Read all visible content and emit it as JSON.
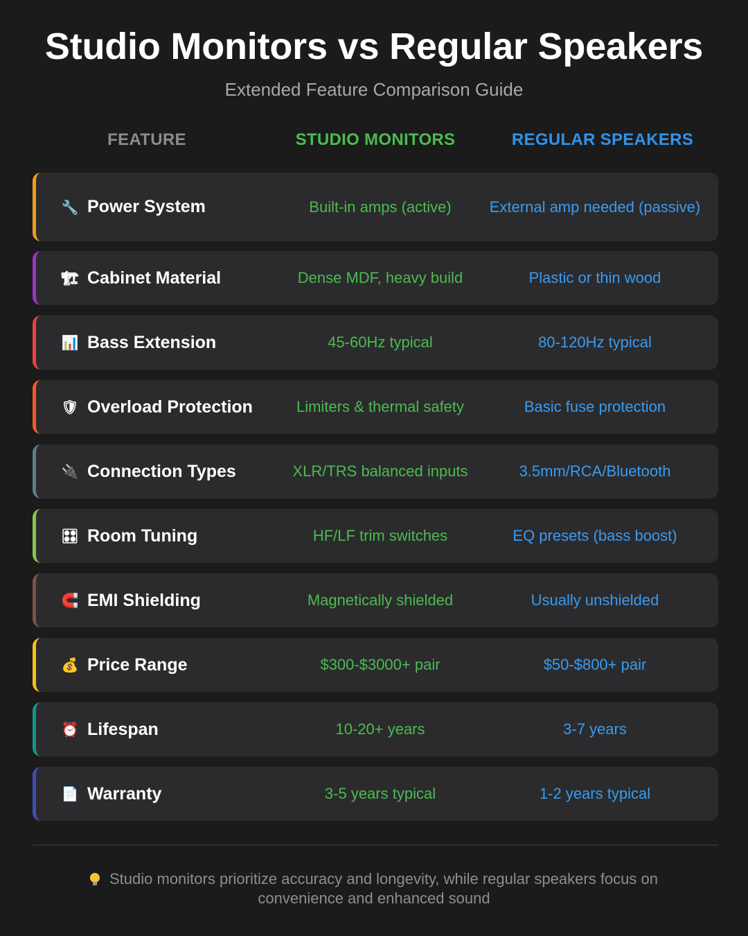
{
  "title": "Studio Monitors vs Regular Speakers",
  "subtitle": "Extended Feature Comparison Guide",
  "columns": {
    "feature": "FEATURE",
    "studio": "STUDIO MONITORS",
    "regular": "REGULAR SPEAKERS"
  },
  "colors": {
    "studio": "#4cbb4f",
    "regular": "#3a9bf0"
  },
  "rows": [
    {
      "feature": "Power System",
      "icon": "wrench-icon",
      "glyph": "🔧",
      "accent": "#f29b1c",
      "studio": "Built-in amps (active)",
      "regular": "External amp needed (passive)"
    },
    {
      "feature": "Cabinet Material",
      "icon": "construction-crane-icon",
      "glyph": "🏗",
      "accent": "#9b36c2",
      "studio": "Dense MDF, heavy build",
      "regular": "Plastic or thin wood"
    },
    {
      "feature": "Bass Extension",
      "icon": "bar-chart-icon",
      "glyph": "📊",
      "accent": "#e8453c",
      "studio": "45-60Hz typical",
      "regular": "80-120Hz typical"
    },
    {
      "feature": "Overload Protection",
      "icon": "shield-icon",
      "glyph": "🛡",
      "accent": "#f1592a",
      "studio": "Limiters & thermal safety",
      "regular": "Basic fuse protection"
    },
    {
      "feature": "Connection Types",
      "icon": "plug-icon",
      "glyph": "🔌",
      "accent": "#5f7d8c",
      "studio": "XLR/TRS balanced inputs",
      "regular": "3.5mm/RCA/Bluetooth"
    },
    {
      "feature": "Room Tuning",
      "icon": "control-knobs-icon",
      "glyph": "🎛",
      "accent": "#8bc34a",
      "studio": "HF/LF trim switches",
      "regular": "EQ presets (bass boost)"
    },
    {
      "feature": "EMI Shielding",
      "icon": "magnet-icon",
      "glyph": "🧲",
      "accent": "#795548",
      "studio": "Magnetically shielded",
      "regular": "Usually unshielded"
    },
    {
      "feature": "Price Range",
      "icon": "money-bag-icon",
      "glyph": "💰",
      "accent": "#f5c016",
      "studio": "$300-$3000+ pair",
      "regular": "$50-$800+ pair"
    },
    {
      "feature": "Lifespan",
      "icon": "alarm-clock-icon",
      "glyph": "⏰",
      "accent": "#119688",
      "studio": "10-20+ years",
      "regular": "3-7 years"
    },
    {
      "feature": "Warranty",
      "icon": "document-icon",
      "glyph": "📄",
      "accent": "#3f4fb5",
      "studio": "3-5 years typical",
      "regular": "1-2 years typical"
    }
  ],
  "footer": {
    "icon": "lightbulb-icon",
    "text": "Studio monitors prioritize accuracy and longevity, while regular speakers focus on convenience and enhanced sound"
  }
}
